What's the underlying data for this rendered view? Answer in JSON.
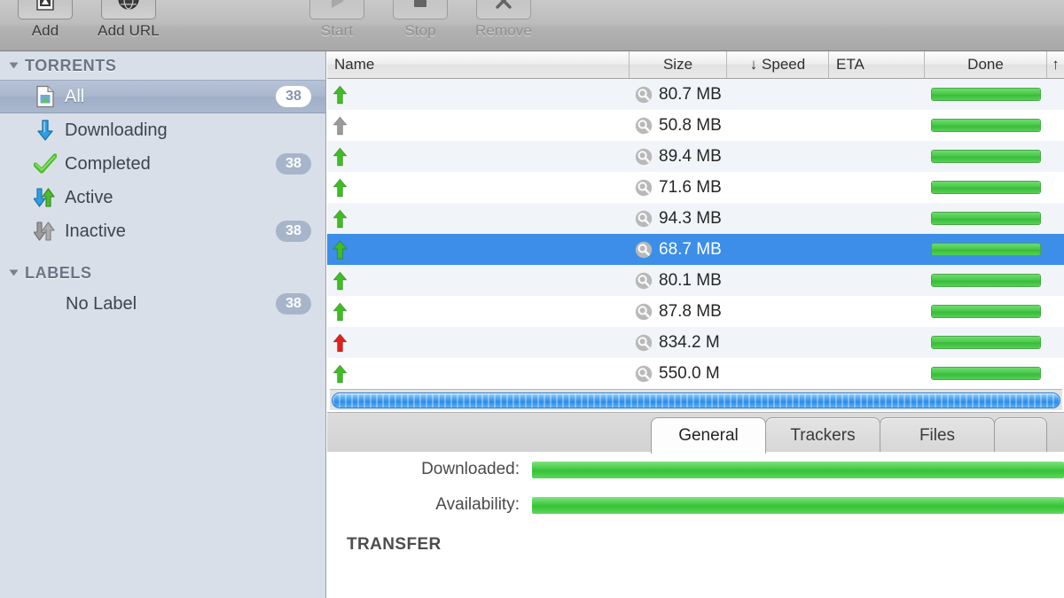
{
  "toolbar": {
    "items": [
      {
        "label": "Add",
        "icon": "add-document-icon",
        "disabled": false
      },
      {
        "label": "Add URL",
        "icon": "globe-icon",
        "disabled": false
      },
      {
        "label": "Start",
        "icon": "play-icon",
        "disabled": true
      },
      {
        "label": "Stop",
        "icon": "stop-square-icon",
        "disabled": true
      },
      {
        "label": "Remove",
        "icon": "x-mark-icon",
        "disabled": true
      }
    ]
  },
  "sidebar": {
    "groups": [
      {
        "title": "TORRENTS",
        "items": [
          {
            "label": "All",
            "icon": "document-icon",
            "badge": "38",
            "selected": true
          },
          {
            "label": "Downloading",
            "icon": "blue-down-arrow-icon",
            "badge": "",
            "selected": false
          },
          {
            "label": "Completed",
            "icon": "green-check-icon",
            "badge": "38",
            "selected": false
          },
          {
            "label": "Active",
            "icon": "blue-green-arrows-icon",
            "badge": "",
            "selected": false
          },
          {
            "label": "Inactive",
            "icon": "gray-arrows-icon",
            "badge": "38",
            "selected": false
          }
        ]
      },
      {
        "title": "LABELS",
        "items": [
          {
            "label": "No Label",
            "icon": "none",
            "badge": "38",
            "selected": false,
            "indent": true
          }
        ]
      }
    ]
  },
  "table": {
    "columns": [
      {
        "key": "name",
        "label": "Name",
        "align": "left"
      },
      {
        "key": "size",
        "label": "Size",
        "align": "center"
      },
      {
        "key": "speed",
        "label": "↓ Speed",
        "align": "center"
      },
      {
        "key": "eta",
        "label": "ETA",
        "align": "left"
      },
      {
        "key": "done",
        "label": "Done",
        "align": "center"
      },
      {
        "key": "up",
        "label": "↑",
        "align": "center"
      }
    ],
    "rows": [
      {
        "name": "",
        "size": "80.7 MB",
        "speed": "",
        "eta": "",
        "done_pct": 100,
        "status": "seeding",
        "selected": false
      },
      {
        "name": "",
        "size": "50.8 MB",
        "speed": "",
        "eta": "",
        "done_pct": 100,
        "status": "paused",
        "selected": false
      },
      {
        "name": "",
        "size": "89.4 MB",
        "speed": "",
        "eta": "",
        "done_pct": 100,
        "status": "seeding",
        "selected": false
      },
      {
        "name": "",
        "size": "71.6 MB",
        "speed": "",
        "eta": "",
        "done_pct": 100,
        "status": "seeding",
        "selected": false
      },
      {
        "name": "",
        "size": "94.3 MB",
        "speed": "",
        "eta": "",
        "done_pct": 100,
        "status": "seeding",
        "selected": false
      },
      {
        "name": "",
        "size": "68.7 MB",
        "speed": "",
        "eta": "",
        "done_pct": 100,
        "status": "seeding",
        "selected": true
      },
      {
        "name": "",
        "size": "80.1 MB",
        "speed": "",
        "eta": "",
        "done_pct": 100,
        "status": "seeding",
        "selected": false
      },
      {
        "name": "",
        "size": "87.8 MB",
        "speed": "",
        "eta": "",
        "done_pct": 100,
        "status": "seeding",
        "selected": false
      },
      {
        "name": "",
        "size": "834.2 M",
        "speed": "",
        "eta": "",
        "done_pct": 100,
        "status": "error",
        "selected": false
      },
      {
        "name": "",
        "size": "550.0 M",
        "speed": "",
        "eta": "",
        "done_pct": 100,
        "status": "seeding",
        "selected": false
      }
    ]
  },
  "tabs": [
    {
      "label": "General",
      "active": true
    },
    {
      "label": "Trackers",
      "active": false
    },
    {
      "label": "Files",
      "active": false
    }
  ],
  "detail": {
    "rows": [
      {
        "label": "Downloaded:",
        "fill_pct": 100
      },
      {
        "label": "Availability:",
        "fill_pct": 100
      }
    ],
    "section_title": "TRANSFER"
  },
  "colors": {
    "accent_selection": "#3c8ee8",
    "progress_green": "#3fc23f",
    "seeding_arrow": "#3fbd22",
    "paused_arrow": "#9a9a9a",
    "error_arrow": "#e02020",
    "sidebar_bg": "#d9dfe8",
    "badge_bg": "#a7b5cb"
  }
}
